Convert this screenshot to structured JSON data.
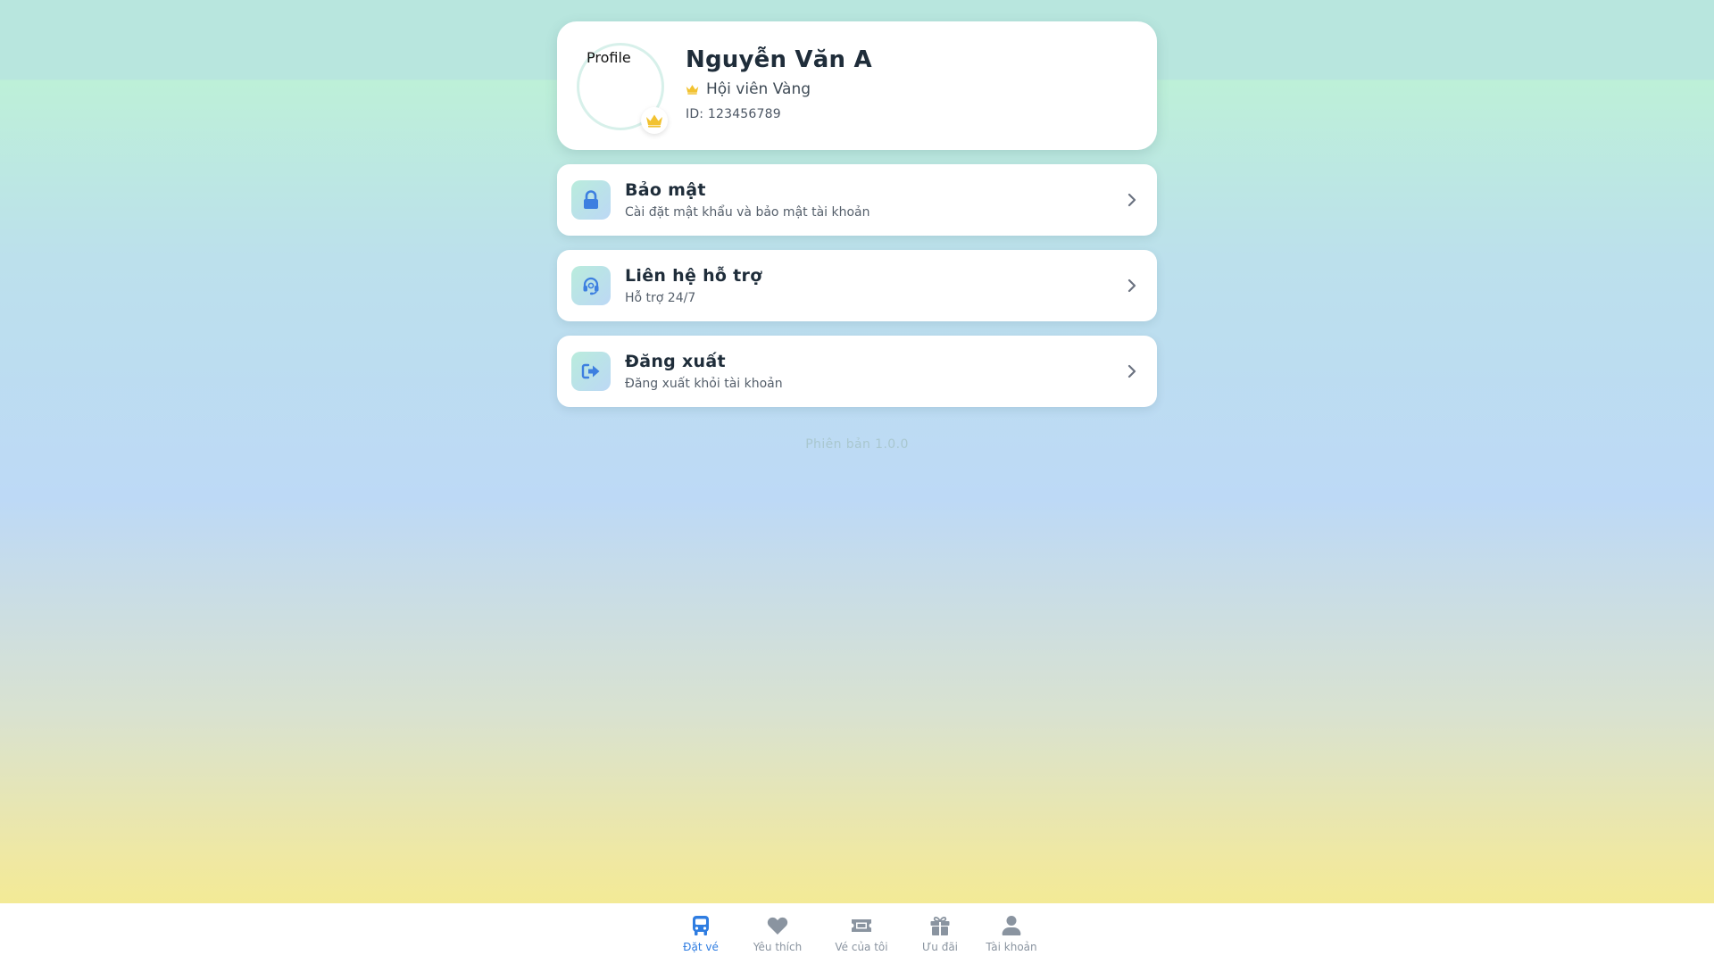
{
  "profile": {
    "avatar_alt": "Profile",
    "name": "Nguyễn Văn A",
    "membership": "Hội viên Vàng",
    "member_id": "ID: 123456789"
  },
  "menu": [
    {
      "title": "Bảo mật",
      "subtitle": "Cài đặt mật khẩu và bảo mật tài khoản",
      "icon": "lock-icon"
    },
    {
      "title": "Liên hệ hỗ trợ",
      "subtitle": "Hỗ trợ 24/7",
      "icon": "headset-icon"
    },
    {
      "title": "Đăng xuất",
      "subtitle": "Đăng xuất khỏi tài khoản",
      "icon": "sign-out-icon"
    }
  ],
  "version": "Phiên bản 1.0.0",
  "nav": [
    {
      "label": "Đặt vé",
      "icon": "bus-icon",
      "active": true
    },
    {
      "label": "Yêu thích",
      "icon": "heart-icon",
      "active": false
    },
    {
      "label": "Vé của tôi",
      "icon": "ticket-icon",
      "active": false
    },
    {
      "label": "Ưu đãi",
      "icon": "gift-icon",
      "active": false
    },
    {
      "label": "Tài khoản",
      "icon": "user-icon",
      "active": false
    }
  ],
  "colors": {
    "accent": "#2f7de1",
    "crown": "#f2c230",
    "icon_blue": "#3d7fe0",
    "nav_inactive": "#8a94a0"
  }
}
